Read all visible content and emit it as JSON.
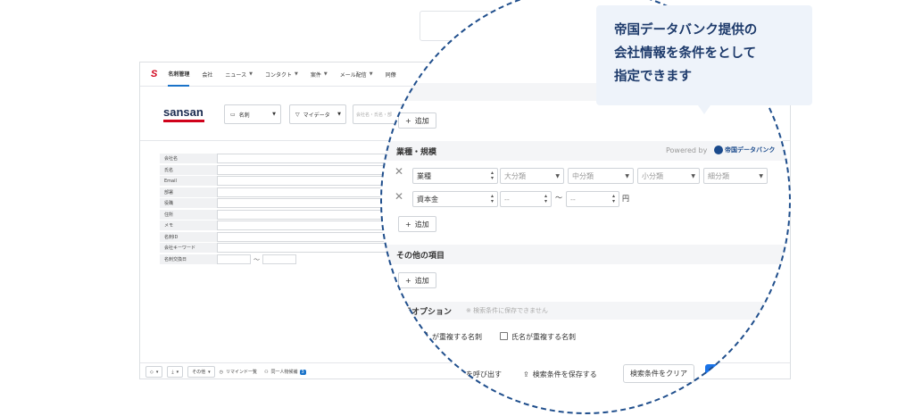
{
  "app": {
    "brand_mark": "S",
    "nav": [
      "名刺管理",
      "会社",
      "ニュース",
      "コンタクト",
      "案件",
      "メール配信",
      "同僚"
    ],
    "nav_dropdown": [
      false,
      false,
      true,
      true,
      true,
      true,
      false
    ],
    "logo": "sansan",
    "card_select": "名刺",
    "filter_select": "マイデータ",
    "search_placeholder": "会社名・氏名・部",
    "form_labels": [
      "会社名",
      "氏名",
      "Email",
      "部署",
      "役職",
      "住所",
      "メモ",
      "名刺ID",
      "会社キーワード",
      "名刺交換日"
    ],
    "date_sep": "〜",
    "bottom": {
      "other": "その他",
      "remind": "リマインド一覧",
      "same_person": "同一人物候補",
      "same_person_count": "3"
    }
  },
  "magnified": {
    "add_label": "追加",
    "industry_section": "業種・規模",
    "powered_by": "Powered by",
    "provider_logo": "帝国データバンク",
    "row1": {
      "first": "業種",
      "s2": "大分類",
      "s3": "中分類",
      "s4": "小分類",
      "s5": "細分類"
    },
    "row2": {
      "first": "資本金",
      "min": "--",
      "max": "--",
      "sep": "〜",
      "unit": "円"
    },
    "other_section": "その他の項目",
    "options_label": "示オプション",
    "options_note": "※ 検索条件に保存できません",
    "opt1": "が重複する名刺",
    "opt2": "氏名が重複する名刺",
    "call_label": "件を呼び出す",
    "save_label": "検索条件を保存する",
    "clear_label": "検索条件をクリア"
  },
  "tooltip": {
    "lines": [
      "帝国データバンク提供の",
      "会社情報を条件をとして",
      "指定できます"
    ]
  },
  "colors": {
    "accent": "#1a73e8",
    "brand_red": "#d0021b",
    "ring": "#1f4e8c",
    "tooltip_bg": "#eef3fa",
    "tooltip_text": "#1d3a6b"
  }
}
